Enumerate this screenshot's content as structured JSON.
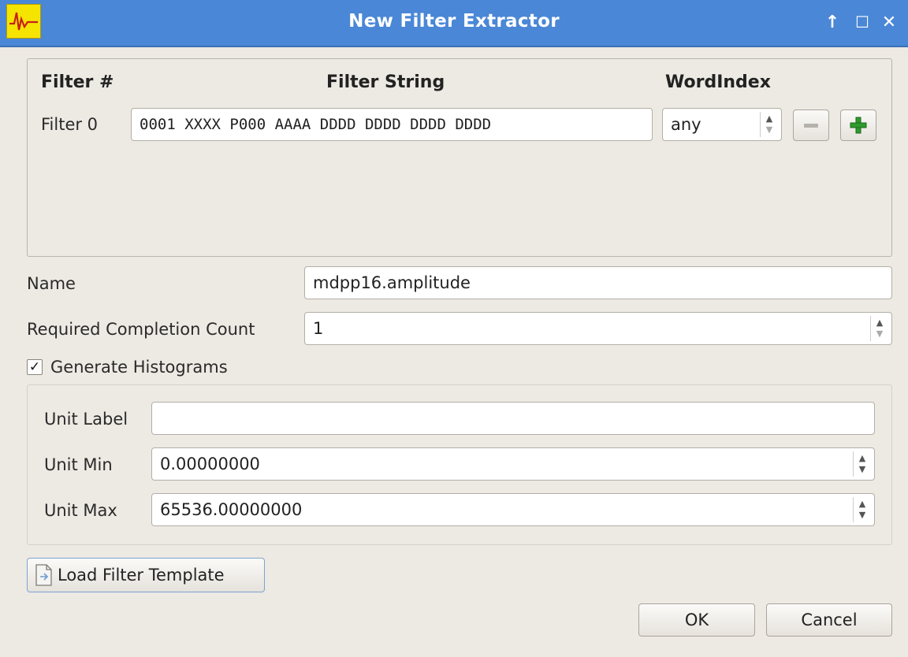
{
  "window": {
    "title": "New  Filter Extractor",
    "controls": {
      "pin": "↑",
      "maximize": "☐",
      "close": "✕"
    }
  },
  "filter_table": {
    "col_filter": "Filter #",
    "col_string": "Filter String",
    "col_wordindex": "WordIndex",
    "rows": [
      {
        "label": "Filter 0",
        "string": "0001  XXXX  P000  AAAA  DDDD  DDDD  DDDD  DDDD",
        "wordindex": "any"
      }
    ]
  },
  "form": {
    "name_label": "Name",
    "name_value": "mdpp16.amplitude",
    "count_label": "Required Completion Count",
    "count_value": "1",
    "histograms_label": "Generate Histograms",
    "histograms_checked": true,
    "unit_label_label": "Unit Label",
    "unit_label_value": "",
    "unit_min_label": "Unit Min",
    "unit_min_value": "0.00000000",
    "unit_max_label": "Unit Max",
    "unit_max_value": "65536.00000000"
  },
  "buttons": {
    "load_template": "Load Filter Template",
    "ok": "OK",
    "cancel": "Cancel"
  },
  "colors": {
    "titlebar": "#4a87d6",
    "window_bg": "#ede9e3",
    "plus_icon": "#2e9a2e"
  }
}
